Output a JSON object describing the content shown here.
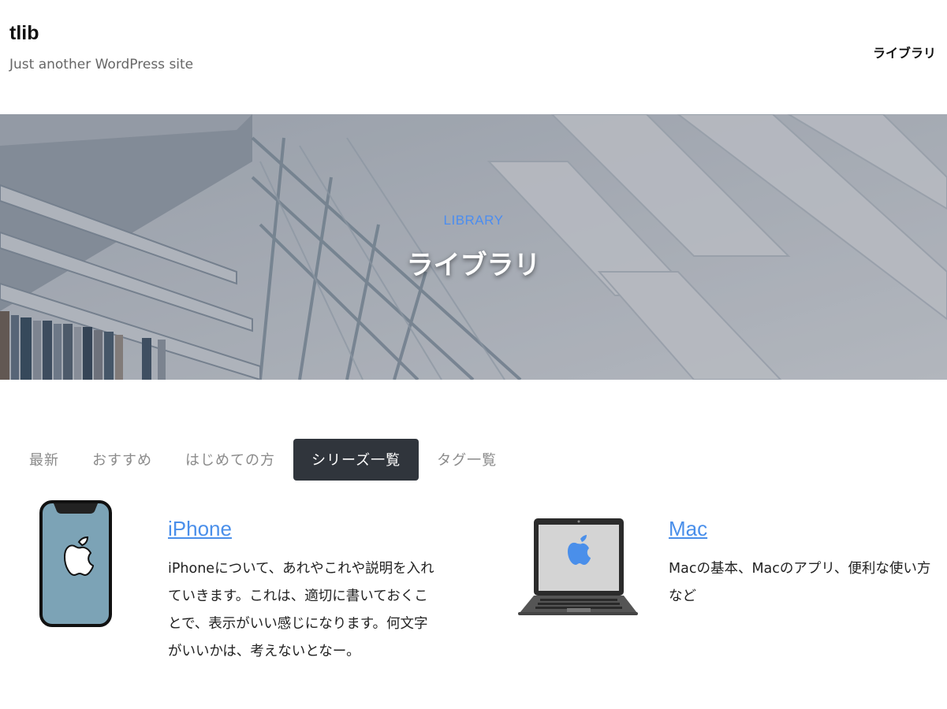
{
  "site": {
    "title": "tlib",
    "tagline": "Just another WordPress site"
  },
  "nav": {
    "link": "ライブラリ"
  },
  "hero": {
    "subtitle": "LIBRARY",
    "title": "ライブラリ"
  },
  "tabs": [
    {
      "label": "最新",
      "active": false
    },
    {
      "label": "おすすめ",
      "active": false
    },
    {
      "label": "はじめての方",
      "active": false
    },
    {
      "label": "シリーズ一覧",
      "active": true
    },
    {
      "label": "タグ一覧",
      "active": false
    }
  ],
  "series": [
    {
      "title": "iPhone",
      "description": "iPhoneについて、あれやこれや説明を入れていきます。これは、適切に書いておくことで、表示がいい感じになります。何文字がいいかは、考えないとなー。",
      "icon": "iphone-icon"
    },
    {
      "title": "Mac",
      "description": "Macの基本、Macのアプリ、便利な使い方など",
      "icon": "macbook-icon"
    }
  ],
  "colors": {
    "accent": "#4a8fea",
    "active_tab_bg": "#30353c",
    "tab_text": "#8a8a8a",
    "hero_subtitle": "#4b8df0"
  }
}
